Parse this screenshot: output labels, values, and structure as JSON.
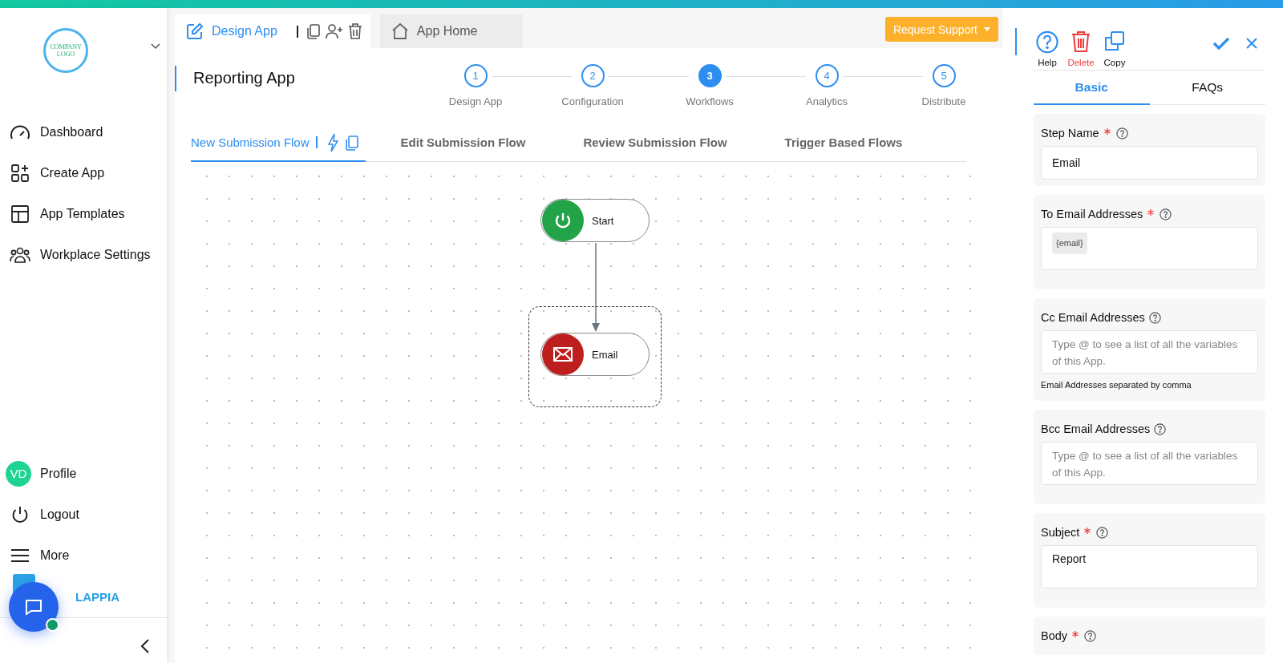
{
  "sidebar": {
    "logo_lines": [
      "COMPANY",
      "LOGO"
    ],
    "nav": [
      {
        "label": "Dashboard",
        "kind": "gauge"
      },
      {
        "label": "Create App",
        "kind": "grid"
      },
      {
        "label": "App Templates",
        "kind": "template"
      },
      {
        "label": "Workplace Settings",
        "kind": "people"
      }
    ],
    "footer": [
      {
        "label": "Profile",
        "kind": "avatar",
        "initials": "VD"
      },
      {
        "label": "Logout",
        "kind": "power"
      },
      {
        "label": "More",
        "kind": "menu"
      }
    ],
    "brand": "LAPPIA"
  },
  "top_tabs": [
    {
      "label": "Design App",
      "kind": "design",
      "selected": true
    },
    {
      "label": "App Home",
      "kind": "home",
      "selected": false
    }
  ],
  "request_support": "Request Support",
  "app_title": "Reporting App",
  "steps": [
    {
      "number": "1",
      "label": "Design App",
      "selected": false
    },
    {
      "number": "2",
      "label": "Configuration",
      "selected": false
    },
    {
      "number": "3",
      "label": "Workflows",
      "selected": true
    },
    {
      "number": "4",
      "label": "Analytics",
      "selected": false
    },
    {
      "number": "5",
      "label": "Distribute",
      "selected": false
    }
  ],
  "flow_tabs": [
    {
      "label": "New Submission Flow",
      "selected": true
    },
    {
      "label": "Edit Submission Flow",
      "selected": false
    },
    {
      "label": "Review Submission Flow",
      "selected": false
    },
    {
      "label": "Trigger Based Flows",
      "selected": false
    }
  ],
  "flow": {
    "nodes": [
      {
        "label": "Start",
        "kind": "start",
        "selected": false
      },
      {
        "label": "Email",
        "kind": "email",
        "selected": true
      }
    ]
  },
  "panel": {
    "actions": [
      {
        "label": "Help",
        "kind": "help"
      },
      {
        "label": "Delete",
        "kind": "delete"
      },
      {
        "label": "Copy",
        "kind": "copy"
      }
    ],
    "tabs": [
      {
        "label": "Basic",
        "selected": true
      },
      {
        "label": "FAQs",
        "selected": false
      }
    ],
    "fields": [
      {
        "label": "Step Name",
        "required": true,
        "kind": "text",
        "value": "Email"
      },
      {
        "label": "To Email Addresses",
        "required": true,
        "kind": "tags",
        "tags": [
          "{email}"
        ]
      },
      {
        "label": "Cc Email Addresses",
        "required": false,
        "kind": "area",
        "placeholder": "Type @ to see a list of all the variables of this App.",
        "hint": "Email Addresses separated by comma"
      },
      {
        "label": "Bcc Email Addresses",
        "required": false,
        "kind": "area",
        "placeholder": "Type @ to see a list of all the variables of this App."
      },
      {
        "label": "Subject",
        "required": true,
        "kind": "area",
        "value": "Report"
      },
      {
        "label": "Body",
        "required": true,
        "kind": "label"
      }
    ]
  }
}
